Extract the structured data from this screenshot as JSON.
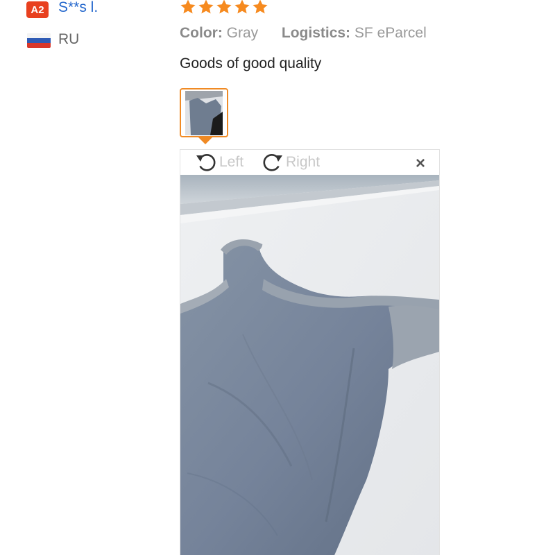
{
  "reviewer": {
    "level": "A2",
    "name": "S**s l.",
    "country": "RU",
    "flag_icon": "russia-flag-icon"
  },
  "review": {
    "stars": 5,
    "star_color": "#f68a1f",
    "color_label": "Color:",
    "color_value": "Gray",
    "logistics_label": "Logistics:",
    "logistics_value": "SF eParcel",
    "text": "Goods of good quality"
  },
  "viewer": {
    "rotate_left_label": "Left",
    "rotate_right_label": "Right",
    "close_label": "×",
    "accent": "#f08a24"
  }
}
